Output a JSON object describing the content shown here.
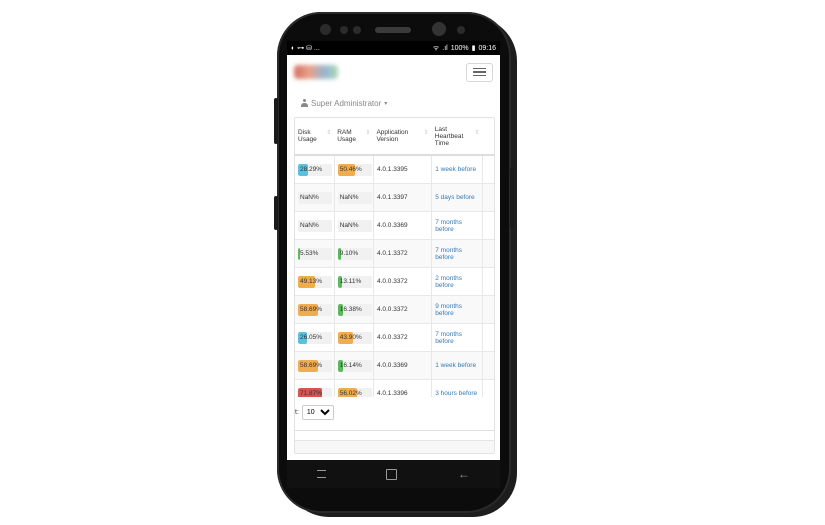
{
  "statusbar": {
    "left_icons": "◐ ⊶ ⛁ ...",
    "wifi": "ᯤ",
    "signal": ".ıl",
    "battery_text": "100%",
    "battery_icon": "▮",
    "time": "09:16"
  },
  "header": {
    "logo": "brand-logo",
    "menu_icon": "hamburger-icon"
  },
  "user": {
    "name": "Super Administrator",
    "icon": "user-icon",
    "caret": "▾"
  },
  "table": {
    "columns": [
      {
        "label_l1": "Disk",
        "label_l2": "Usage",
        "label_l3": ""
      },
      {
        "label_l1": "RAM",
        "label_l2": "Usage",
        "label_l3": ""
      },
      {
        "label_l1": "Application",
        "label_l2": "Version",
        "label_l3": ""
      },
      {
        "label_l1": "Last",
        "label_l2": "Heartbeat",
        "label_l3": "Time"
      }
    ],
    "sort_icon": "⇕",
    "rows": [
      {
        "disk": "28.29%",
        "disk_pct": 28.29,
        "disk_color": "#5bc0de",
        "ram": "50.46%",
        "ram_pct": 50.46,
        "ram_color": "#f0ad4e",
        "version": "4.0.1.3395",
        "heartbeat_l1": "1 week before",
        "heartbeat_l2": ""
      },
      {
        "disk": "NaN%",
        "disk_pct": 0,
        "disk_color": "#5bc0de",
        "ram": "NaN%",
        "ram_pct": 0,
        "ram_color": "#f0ad4e",
        "version": "4.0.1.3397",
        "heartbeat_l1": "5 days before",
        "heartbeat_l2": ""
      },
      {
        "disk": "NaN%",
        "disk_pct": 0,
        "disk_color": "#5bc0de",
        "ram": "NaN%",
        "ram_pct": 0,
        "ram_color": "#f0ad4e",
        "version": "4.0.0.3369",
        "heartbeat_l1": "7 months",
        "heartbeat_l2": "before"
      },
      {
        "disk": "5.53%",
        "disk_pct": 5.53,
        "disk_color": "#5cb85c",
        "ram": "9.10%",
        "ram_pct": 9.1,
        "ram_color": "#5cb85c",
        "version": "4.0.1.3372",
        "heartbeat_l1": "7 months",
        "heartbeat_l2": "before"
      },
      {
        "disk": "49.13%",
        "disk_pct": 49.13,
        "disk_color": "#f0ad4e",
        "ram": "13.11%",
        "ram_pct": 13.11,
        "ram_color": "#5cb85c",
        "version": "4.0.0.3372",
        "heartbeat_l1": "2 months",
        "heartbeat_l2": "before"
      },
      {
        "disk": "58.69%",
        "disk_pct": 58.69,
        "disk_color": "#f0ad4e",
        "ram": "16.38%",
        "ram_pct": 16.38,
        "ram_color": "#5cb85c",
        "version": "4.0.0.3372",
        "heartbeat_l1": "9 months",
        "heartbeat_l2": "before"
      },
      {
        "disk": "26.05%",
        "disk_pct": 26.05,
        "disk_color": "#5bc0de",
        "ram": "43.90%",
        "ram_pct": 43.9,
        "ram_color": "#f0ad4e",
        "version": "4.0.0.3372",
        "heartbeat_l1": "7 months",
        "heartbeat_l2": "before"
      },
      {
        "disk": "58.69%",
        "disk_pct": 58.69,
        "disk_color": "#f0ad4e",
        "ram": "16.14%",
        "ram_pct": 16.14,
        "ram_color": "#5cb85c",
        "version": "4.0.0.3369",
        "heartbeat_l1": "1 week before",
        "heartbeat_l2": ""
      },
      {
        "disk": "71.87%",
        "disk_pct": 71.87,
        "disk_color": "#d9534f",
        "ram": "56.02%",
        "ram_pct": 56.02,
        "ram_color": "#f0ad4e",
        "version": "4.0.1.3396",
        "heartbeat_l1": "3 hours before",
        "heartbeat_l2": ""
      }
    ]
  },
  "pager": {
    "label": "t:",
    "page_size": "10",
    "options": [
      "10"
    ]
  },
  "navbar": {
    "recent_icon": "recent-apps-icon",
    "home_icon": "home-icon",
    "back_icon": "back-icon",
    "back_glyph": "←"
  }
}
